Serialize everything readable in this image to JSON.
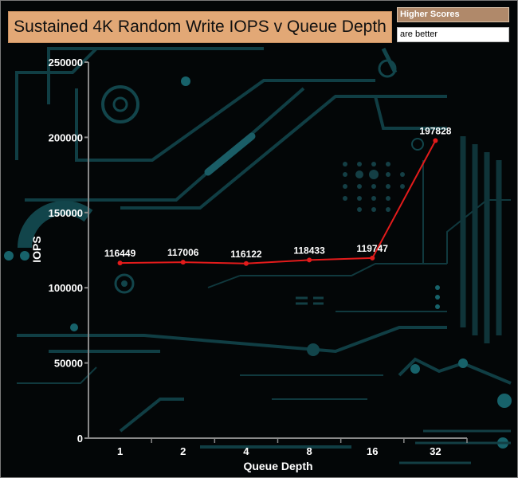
{
  "colors": {
    "title_bg": "#e2a876",
    "higher_bg": "#b0896a",
    "line": "#e31b1b",
    "axis": "#8a8a8a",
    "circuit": "#12454b"
  },
  "legend": {
    "higher_scores": "Higher Scores",
    "are_better": "are better"
  },
  "chart_data": {
    "type": "line",
    "title": "Sustained 4K Random Write IOPS v Queue Depth",
    "xlabel": "Queue Depth",
    "ylabel": "IOPS",
    "categories": [
      "1",
      "2",
      "4",
      "8",
      "16",
      "32"
    ],
    "series": [
      {
        "values": [
          116449,
          117006,
          116122,
          118433,
          119747,
          197828
        ]
      }
    ],
    "data_labels": [
      "116449",
      "117006",
      "116122",
      "118433",
      "119747",
      "197828"
    ],
    "ylim": [
      0,
      250000
    ],
    "yticks": [
      0,
      50000,
      100000,
      150000,
      200000,
      250000
    ],
    "ytick_labels": [
      "0",
      "50000",
      "100000",
      "150000",
      "200000",
      "250000"
    ],
    "grid": false,
    "legend": "none"
  }
}
